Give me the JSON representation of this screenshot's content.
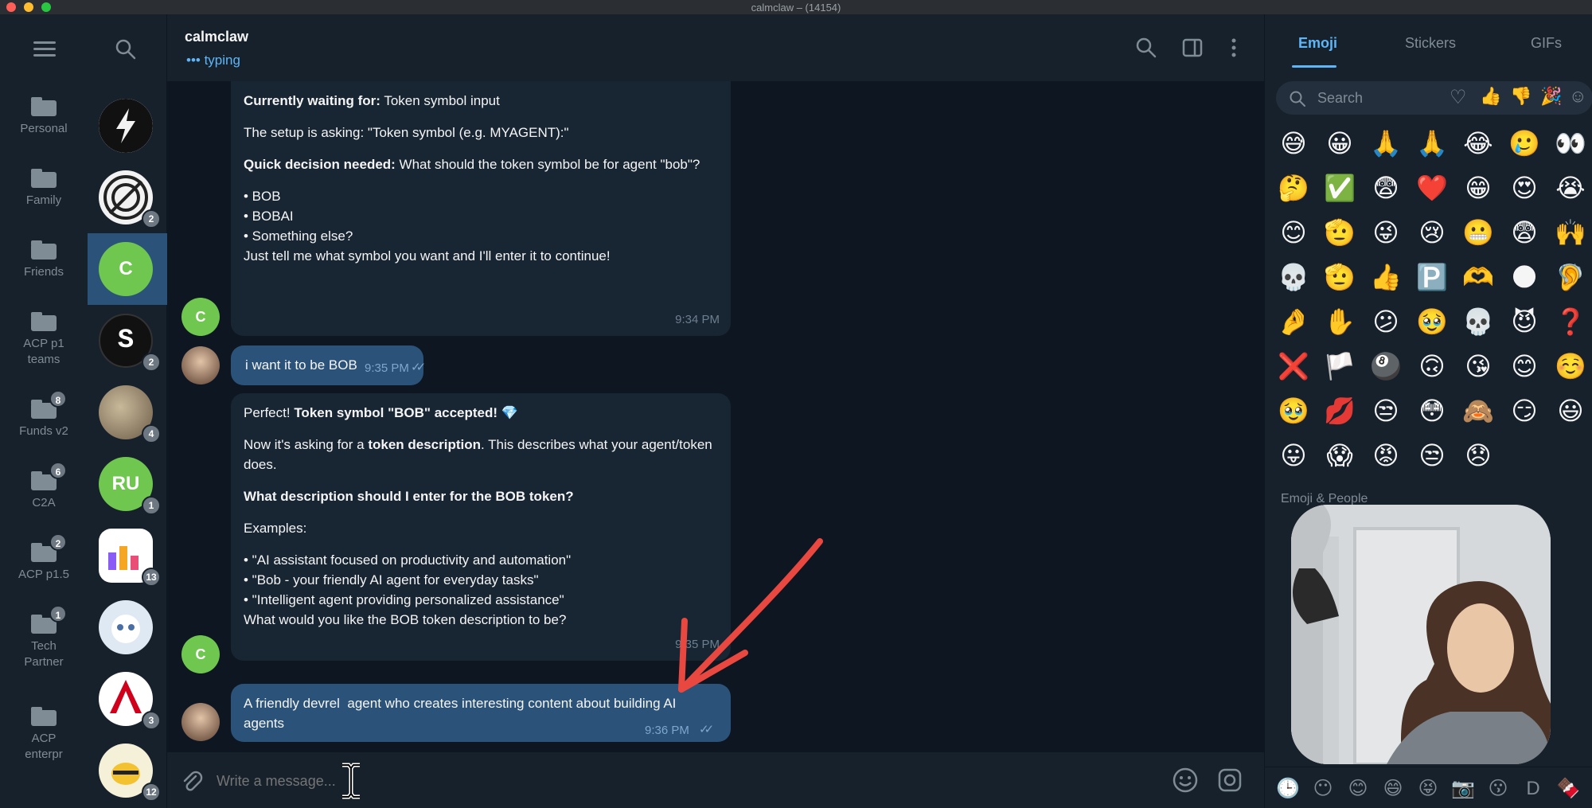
{
  "window": {
    "title": "calmclaw – (14154)"
  },
  "folders": [
    {
      "label": "Personal",
      "badge": ""
    },
    {
      "label": "Family",
      "badge": ""
    },
    {
      "label": "Friends",
      "badge": ""
    },
    {
      "label": "ACP p1 teams",
      "badge": ""
    },
    {
      "label": "Funds v2",
      "badge": "8"
    },
    {
      "label": "C2A",
      "badge": "6"
    },
    {
      "label": "ACP p1.5",
      "badge": "2"
    },
    {
      "label": "Tech Partner",
      "badge": "1"
    },
    {
      "label": "ACP enterpr",
      "badge": ""
    }
  ],
  "chats": [
    {
      "initials": "",
      "badge": ""
    },
    {
      "initials": "",
      "badge": "2"
    },
    {
      "initials": "C",
      "badge": ""
    },
    {
      "initials": "S",
      "badge": "2"
    },
    {
      "initials": "",
      "badge": "4"
    },
    {
      "initials": "RU",
      "badge": "1"
    },
    {
      "initials": "",
      "badge": "13"
    },
    {
      "initials": "",
      "badge": ""
    },
    {
      "initials": "",
      "badge": "3"
    },
    {
      "initials": "",
      "badge": "12"
    }
  ],
  "header": {
    "name": "calmclaw",
    "status": "••• typing"
  },
  "messages": {
    "m1": {
      "line1_bold": "Currently waiting for:",
      "line1_rest": " Token symbol input",
      "line2": "The setup is asking: \"Token symbol (e.g. MYAGENT):\"",
      "line3_bold": "Quick decision needed:",
      "line3_rest": " What should the token symbol be for agent \"bob\"?",
      "opt1": "• BOB",
      "opt2": "• BOBAI",
      "opt3": "• Something else?",
      "line4": "Just tell me what symbol you want and I'll enter it to continue!",
      "time": "9:34 PM",
      "avatar": "C"
    },
    "m2": {
      "text": "i want it to be BOB",
      "time": "9:35 PM"
    },
    "m3": {
      "line1_a": "Perfect! ",
      "line1_bold": "Token symbol \"BOB\" accepted!",
      "line1_emoji": " 💎",
      "line2_a": "Now it's asking for a ",
      "line2_bold": "token description",
      "line2_b": ". This describes what your agent/token does.",
      "line3_bold": "What description should I enter for the BOB token?",
      "line4": "Examples:",
      "ex1": "• \"AI assistant focused on productivity and automation\"",
      "ex2": "• \"Bob - your friendly AI agent for everyday tasks\"",
      "ex3": "• \"Intelligent agent providing personalized assistance\"",
      "line5": "What would you like the BOB token description to be?",
      "time": "9:35 PM",
      "avatar": "C"
    },
    "m4": {
      "text": "A friendly devrel  agent who creates interesting content about building AI agents",
      "time": "9:36 PM"
    }
  },
  "input": {
    "placeholder": "Write a message..."
  },
  "emoji_panel": {
    "tabs": [
      "Emoji",
      "Stickers",
      "GIFs"
    ],
    "search_placeholder": "Search",
    "recent": [
      "😅",
      "😀",
      "🙏",
      "🙏",
      "😂",
      "🥲",
      "👀",
      "🤔",
      "✅",
      "😨",
      "❤️",
      "😁",
      "😍",
      "😭",
      "😊",
      "🫡",
      "😜",
      "😢",
      "😬",
      "😨",
      "🙌",
      "💀",
      "🫡",
      "👍",
      "🅿️",
      "🫶",
      "🌑",
      "🦻",
      "🤌",
      "✋",
      "😕",
      "🥹",
      "💀",
      "😈",
      "❓",
      "❌",
      "🏳️",
      "🎱",
      "🙃",
      "😘",
      "😊",
      "☺️",
      "🥹",
      "💋",
      "😒",
      "😳",
      "🙈",
      "😏",
      "😃",
      "😛",
      "😱",
      "😡",
      "😒",
      "😞"
    ],
    "section_label": "Emoji & People",
    "categories": [
      "🕒",
      "😶",
      "😊",
      "😄",
      "😝",
      "📷",
      "😗",
      "D",
      "🍫"
    ]
  },
  "colors": {
    "bg": "#0e1621",
    "panel": "#17212b",
    "bubble_in": "#182533",
    "bubble_out": "#2b5278",
    "accent": "#5eb5f7",
    "annotation_arrow": "#e8483f"
  }
}
